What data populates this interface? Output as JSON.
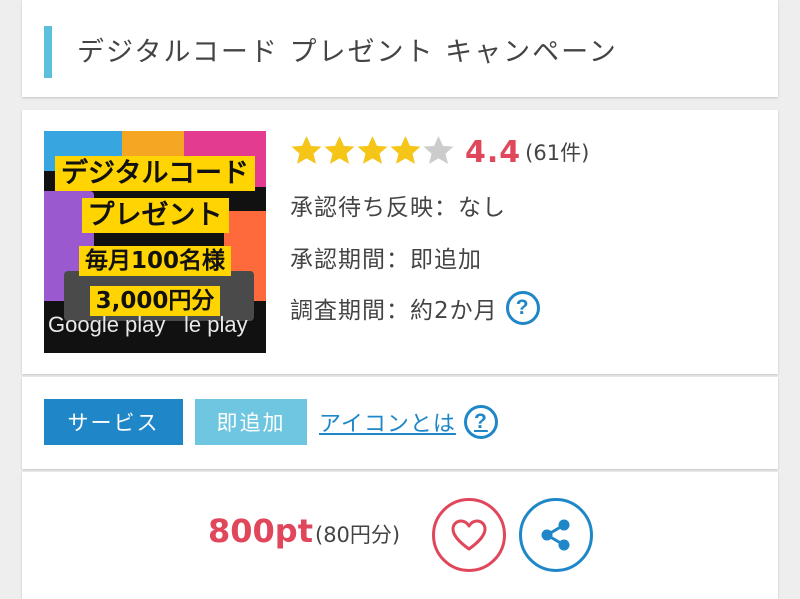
{
  "header": {
    "title": "デジタルコード プレゼント キャンペーン"
  },
  "thumbnail": {
    "line1": "デジタルコード",
    "line2": "プレゼント",
    "line3": "毎月100名様",
    "line4": "3,000円分",
    "brand_left": "Google play",
    "brand_right": "le play"
  },
  "rating": {
    "value_num": 4.4,
    "value": "4.4",
    "count": "(61件)",
    "stars_full": 4,
    "stars_total": 5,
    "star_color": "#f5c518",
    "star_empty_color": "#cccccc"
  },
  "meta": {
    "pending": "承認待ち反映：なし",
    "approval": "承認期間：即追加",
    "survey": "調査期間：約2か月",
    "help_symbol": "?"
  },
  "badges": {
    "service": "サービス",
    "instant": "即追加",
    "icon_link": "アイコンとは",
    "help_symbol": "?"
  },
  "reward": {
    "points": "800pt",
    "yen": "(80円分)"
  },
  "actions": {
    "favorite_icon": "heart-icon",
    "share_icon": "share-icon"
  },
  "colors": {
    "accent_blue": "#1f87c8",
    "light_blue": "#6ec6e0",
    "title_bar": "#5bc0de",
    "accent_red": "#e0475b"
  }
}
